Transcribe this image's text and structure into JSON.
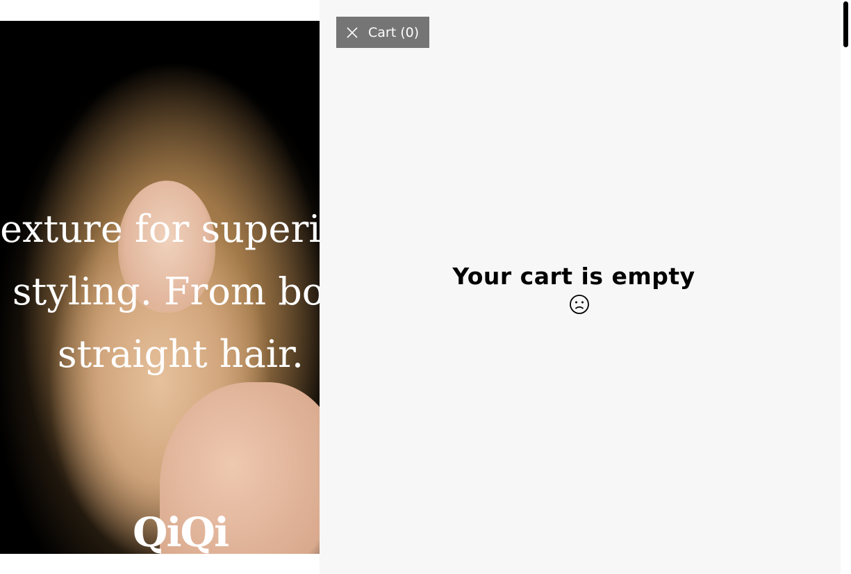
{
  "hero": {
    "lines": [
      "exture for superior",
      "styling. From bou",
      "straight hair."
    ],
    "logo": "QiQi"
  },
  "cart": {
    "close_icon": "close-icon",
    "label": "Cart (0)",
    "empty_message": "Your cart is empty",
    "empty_icon": "sad-face-icon"
  },
  "colors": {
    "drawer_bg": "#f7f7f7",
    "button_bg": "#757575"
  }
}
